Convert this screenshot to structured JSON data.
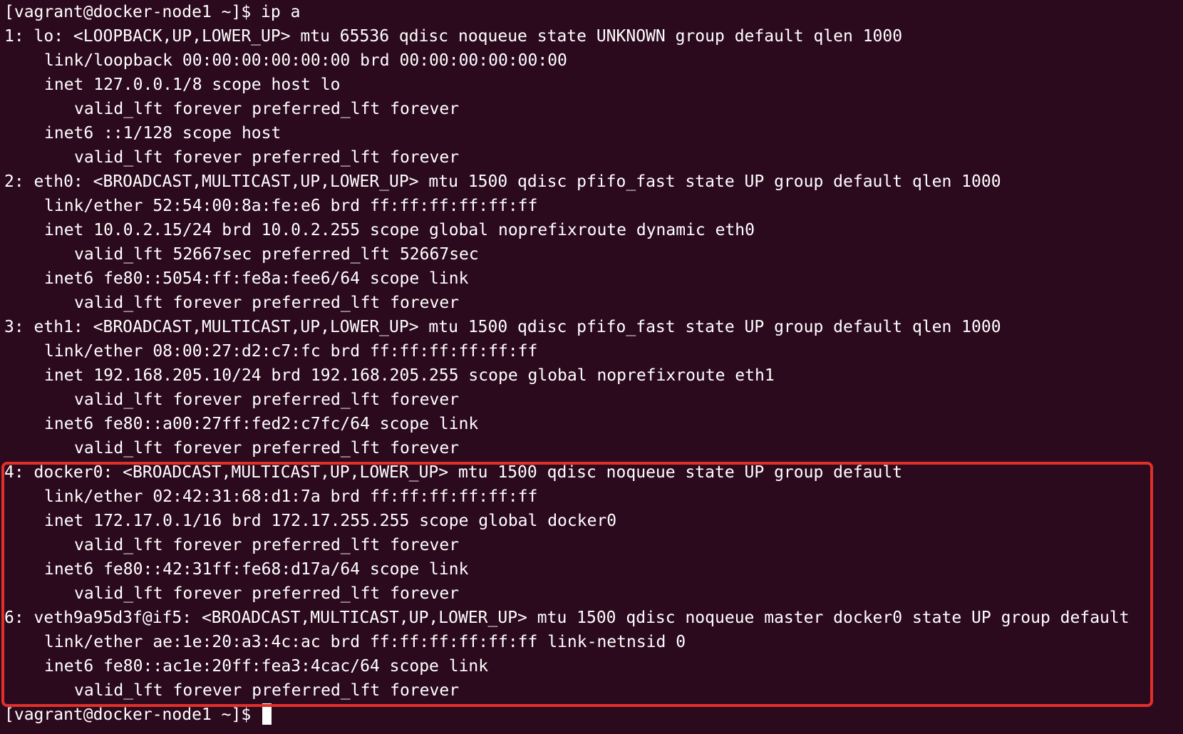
{
  "terminal": {
    "lines": [
      {
        "text": "[vagrant@docker-node1 ~]$ ip a",
        "indent": 0
      },
      {
        "text": "1: lo: <LOOPBACK,UP,LOWER_UP> mtu 65536 qdisc noqueue state UNKNOWN group default qlen 1000",
        "indent": 0
      },
      {
        "text": "link/loopback 00:00:00:00:00:00 brd 00:00:00:00:00:00",
        "indent": 1
      },
      {
        "text": "inet 127.0.0.1/8 scope host lo",
        "indent": 1
      },
      {
        "text": "valid_lft forever preferred_lft forever",
        "indent": 2
      },
      {
        "text": "inet6 ::1/128 scope host",
        "indent": 1
      },
      {
        "text": "valid_lft forever preferred_lft forever",
        "indent": 2
      },
      {
        "text": "2: eth0: <BROADCAST,MULTICAST,UP,LOWER_UP> mtu 1500 qdisc pfifo_fast state UP group default qlen 1000",
        "indent": 0
      },
      {
        "text": "link/ether 52:54:00:8a:fe:e6 brd ff:ff:ff:ff:ff:ff",
        "indent": 1
      },
      {
        "text": "inet 10.0.2.15/24 brd 10.0.2.255 scope global noprefixroute dynamic eth0",
        "indent": 1
      },
      {
        "text": "valid_lft 52667sec preferred_lft 52667sec",
        "indent": 2
      },
      {
        "text": "inet6 fe80::5054:ff:fe8a:fee6/64 scope link",
        "indent": 1
      },
      {
        "text": "valid_lft forever preferred_lft forever",
        "indent": 2
      },
      {
        "text": "3: eth1: <BROADCAST,MULTICAST,UP,LOWER_UP> mtu 1500 qdisc pfifo_fast state UP group default qlen 1000",
        "indent": 0
      },
      {
        "text": "link/ether 08:00:27:d2:c7:fc brd ff:ff:ff:ff:ff:ff",
        "indent": 1
      },
      {
        "text": "inet 192.168.205.10/24 brd 192.168.205.255 scope global noprefixroute eth1",
        "indent": 1
      },
      {
        "text": "valid_lft forever preferred_lft forever",
        "indent": 2
      },
      {
        "text": "inet6 fe80::a00:27ff:fed2:c7fc/64 scope link",
        "indent": 1
      },
      {
        "text": "valid_lft forever preferred_lft forever",
        "indent": 2
      },
      {
        "text": "4: docker0: <BROADCAST,MULTICAST,UP,LOWER_UP> mtu 1500 qdisc noqueue state UP group default",
        "indent": 0
      },
      {
        "text": "link/ether 02:42:31:68:d1:7a brd ff:ff:ff:ff:ff:ff",
        "indent": 1
      },
      {
        "text": "inet 172.17.0.1/16 brd 172.17.255.255 scope global docker0",
        "indent": 1
      },
      {
        "text": "valid_lft forever preferred_lft forever",
        "indent": 2
      },
      {
        "text": "inet6 fe80::42:31ff:fe68:d17a/64 scope link",
        "indent": 1
      },
      {
        "text": "valid_lft forever preferred_lft forever",
        "indent": 2
      },
      {
        "text": "6: veth9a95d3f@if5: <BROADCAST,MULTICAST,UP,LOWER_UP> mtu 1500 qdisc noqueue master docker0 state UP group default",
        "indent": 0
      },
      {
        "text": "link/ether ae:1e:20:a3:4c:ac brd ff:ff:ff:ff:ff:ff link-netnsid 0",
        "indent": 1
      },
      {
        "text": "inet6 fe80::ac1e:20ff:fea3:4cac/64 scope link",
        "indent": 1
      },
      {
        "text": "valid_lft forever preferred_lft forever",
        "indent": 2
      }
    ],
    "prompt": "[vagrant@docker-node1 ~]$ ",
    "colors": {
      "background": "#2c0a1e",
      "text": "#ffffff",
      "highlight_border": "#e0302a"
    }
  }
}
